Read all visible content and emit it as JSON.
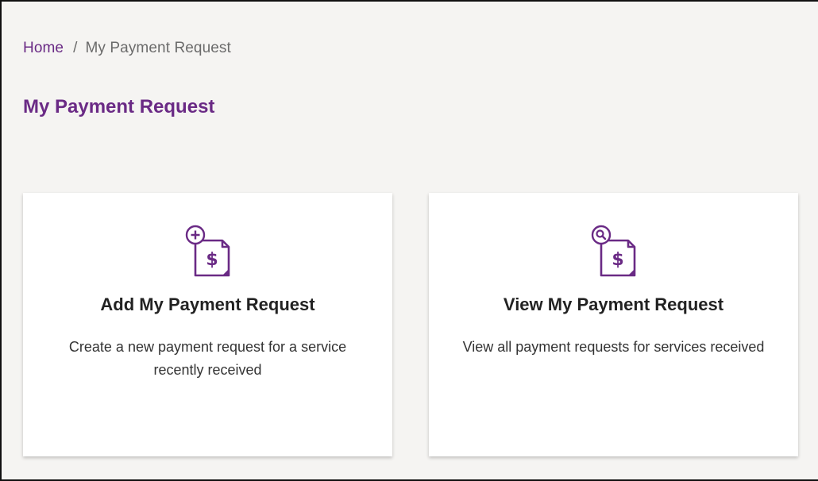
{
  "breadcrumb": {
    "home": "Home",
    "separator": "/",
    "current": "My Payment Request"
  },
  "page": {
    "title": "My Payment Request"
  },
  "cards": [
    {
      "title": "Add My Payment Request",
      "description": "Create a new payment request for a service recently received",
      "icon": "add-invoice-icon"
    },
    {
      "title": "View My Payment Request",
      "description": "View all payment requests for services received",
      "icon": "search-invoice-icon"
    }
  ],
  "colors": {
    "accent": "#6a2a85",
    "background": "#f5f4f2",
    "card": "#ffffff"
  }
}
